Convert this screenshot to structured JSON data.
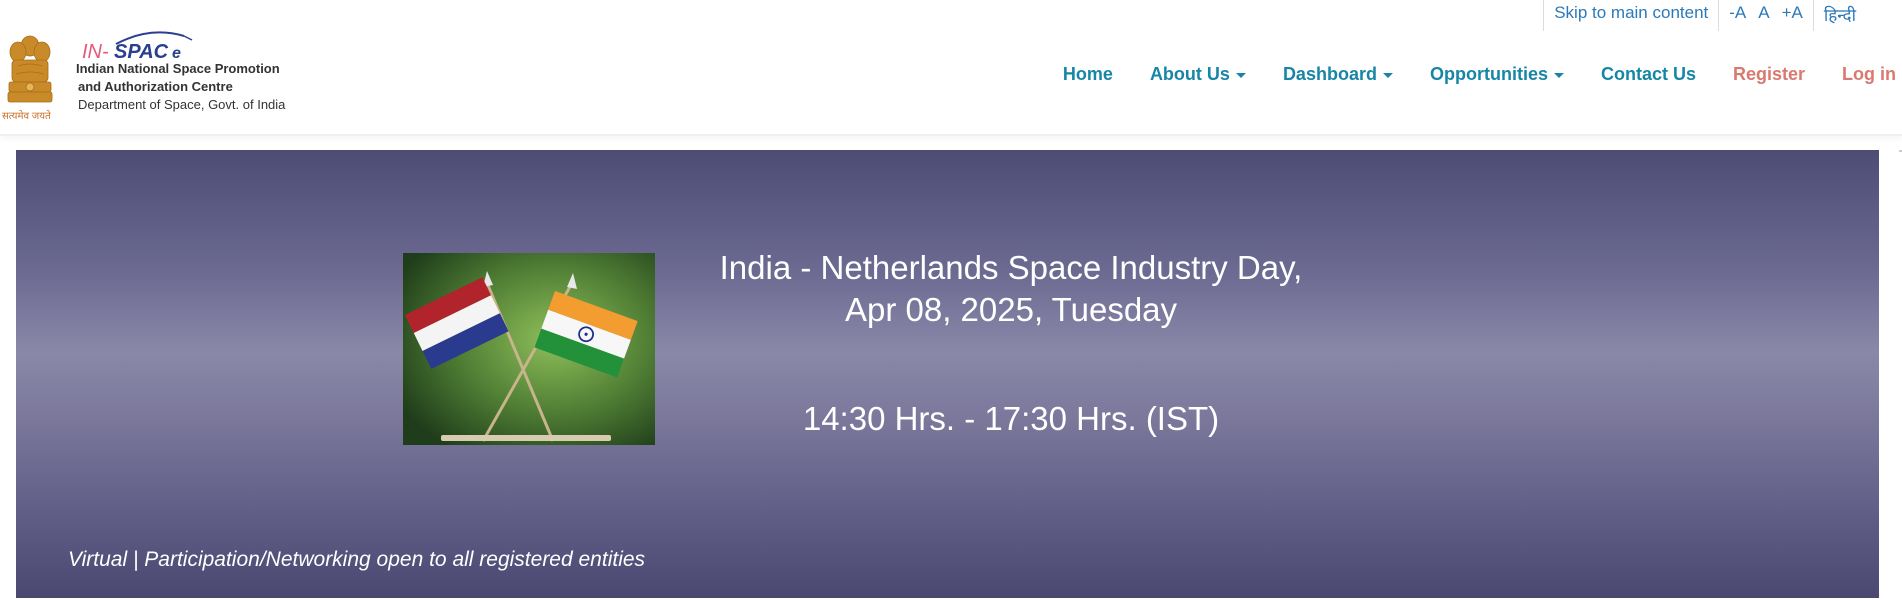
{
  "topbar": {
    "skip_link": "Skip to main content",
    "font_decrease": "-A",
    "font_normal": "A",
    "font_increase": "+A",
    "language": "हिन्दी"
  },
  "brand": {
    "logo_text": "IN-SPACe",
    "org_line1": "Indian National Space Promotion",
    "org_line2": "and Authorization Centre",
    "department": "Department of Space, Govt. of India",
    "emblem_motto": "सत्यमेव जयते"
  },
  "nav": {
    "items": [
      {
        "label": "Home",
        "dropdown": false
      },
      {
        "label": "About Us",
        "dropdown": true
      },
      {
        "label": "Dashboard",
        "dropdown": true
      },
      {
        "label": "Opportunities",
        "dropdown": true
      },
      {
        "label": "Contact Us",
        "dropdown": false
      }
    ],
    "register": "Register",
    "login": "Log in"
  },
  "banner": {
    "title_line1": "India - Netherlands Space Industry Day,",
    "title_line2": "Apr 08, 2025, Tuesday",
    "time": "14:30 Hrs. - 17:30 Hrs. (IST)",
    "footer": "Virtual | Participation/Networking open to all registered entities"
  },
  "colors": {
    "nav_link": "#1786a6",
    "auth_link": "#d9796f",
    "top_link": "#2b79b8",
    "banner_dark": "#4d4c75",
    "banner_light": "#8a88a8"
  }
}
